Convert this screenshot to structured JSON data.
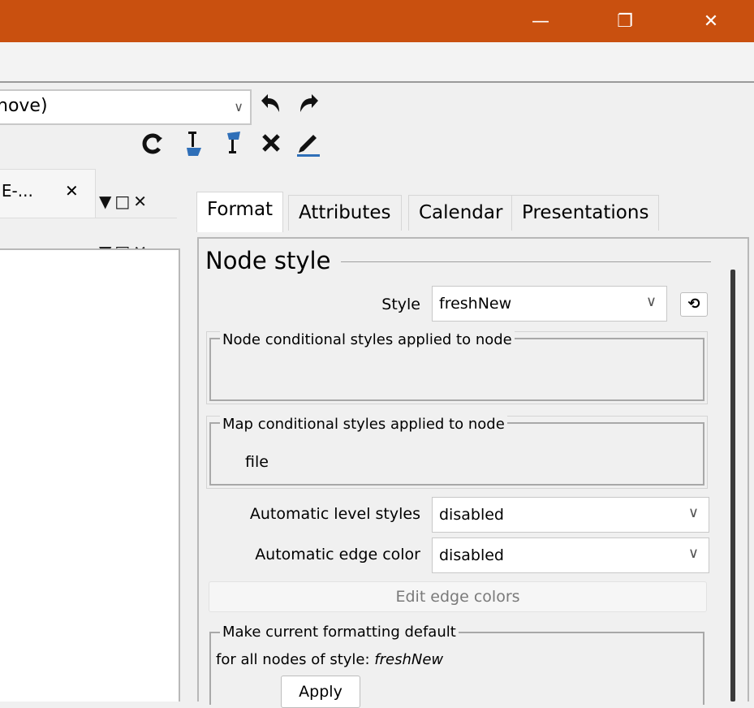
{
  "window": {
    "minimize_icon": "—",
    "restore_icon": "❐",
    "close_icon": "✕"
  },
  "toolbar": {
    "filter_combo_value": "nove)",
    "undo_icon": "↶",
    "redo_icon": "↷",
    "refresh_icon": "↻",
    "icons": [
      "C",
      "filter-down-icon",
      "filter-up-icon",
      "clear-icon",
      "edit-icon"
    ]
  },
  "left_panel": {
    "tab_label": "IE-...",
    "tab_close": "✕",
    "dock_controls": "▼□✕"
  },
  "right_panel": {
    "tabs": [
      {
        "label": "Format"
      },
      {
        "label": "Attributes"
      },
      {
        "label": "Calendar"
      },
      {
        "label": "Presentations"
      }
    ],
    "node_style": {
      "section_title": "Node style",
      "style_label": "Style",
      "style_value": "freshNew",
      "node_conditional_title": "Node conditional styles applied to node",
      "map_conditional_title": "Map conditional styles applied to node",
      "map_conditional_value": "file",
      "auto_level_label": "Automatic level styles",
      "auto_level_value": "disabled",
      "auto_edge_label": "Automatic edge color",
      "auto_edge_value": "disabled",
      "edit_edge_colors": "Edit edge colors",
      "make_default_title": "Make current formatting default",
      "for_all_text": "for all nodes of style: ",
      "for_all_style": "freshNew",
      "apply_label": "Apply"
    }
  },
  "colors": {
    "titlebar": "#c9500f",
    "panel": "#f0f0f0",
    "edge_icon_blue": "#2f6fb8"
  }
}
